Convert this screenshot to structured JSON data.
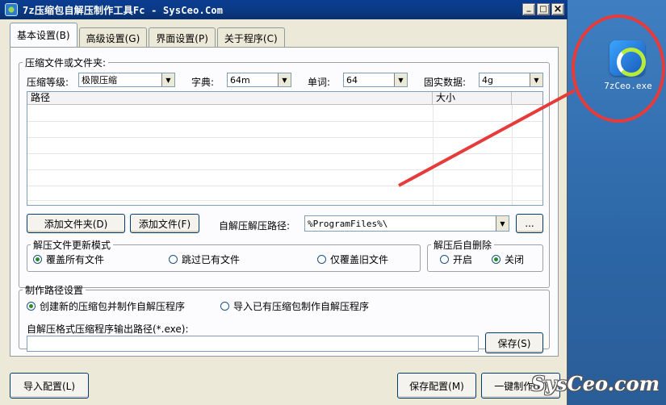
{
  "window": {
    "title": "7z压缩包自解压制作工具Fc - SysCeo.Com"
  },
  "tabs": [
    {
      "label": "基本设置(B)",
      "active": true
    },
    {
      "label": "高级设置(G)",
      "active": false
    },
    {
      "label": "界面设置(P)",
      "active": false
    },
    {
      "label": "关于程序(C)",
      "active": false
    }
  ],
  "compress": {
    "group_label": "压缩文件或文件夹:",
    "level_label": "压缩等级:",
    "level_value": "极限压缩",
    "dict_label": "字典:",
    "dict_value": "64m",
    "word_label": "单词:",
    "word_value": "64",
    "solid_label": "固实数据:",
    "solid_value": "4g",
    "list_columns": [
      "路径",
      "大小"
    ],
    "add_folder_button": "添加文件夹(D)",
    "add_file_button": "添加文件(F)",
    "extract_path_label": "自解压解压路径:",
    "extract_path_value": "%ProgramFiles%\\",
    "browse_button": "..."
  },
  "update_mode": {
    "group_label": "解压文件更新模式",
    "options": [
      {
        "label": "覆盖所有文件",
        "checked": true
      },
      {
        "label": "跳过已有文件",
        "checked": false
      },
      {
        "label": "仅覆盖旧文件",
        "checked": false
      }
    ]
  },
  "self_delete": {
    "group_label": "解压后自删除",
    "options": [
      {
        "label": "开启",
        "checked": false
      },
      {
        "label": "关闭",
        "checked": true
      }
    ]
  },
  "make_path": {
    "group_label": "制作路径设置",
    "options": [
      {
        "label": "创建新的压缩包并制作自解压程序",
        "checked": true
      },
      {
        "label": "导入已有压缩包制作自解压程序",
        "checked": false
      }
    ],
    "output_label": "自解压格式压缩程序输出路径(*.exe):",
    "output_value": "",
    "save_button": "保存(S)"
  },
  "footer": {
    "import_button": "导入配置(L)",
    "save_config_button": "保存配置(M)",
    "one_click_button": "一键制作(B)"
  },
  "desktop": {
    "icon_label": "7zCeo.exe",
    "watermark": "SysCeo.com"
  }
}
